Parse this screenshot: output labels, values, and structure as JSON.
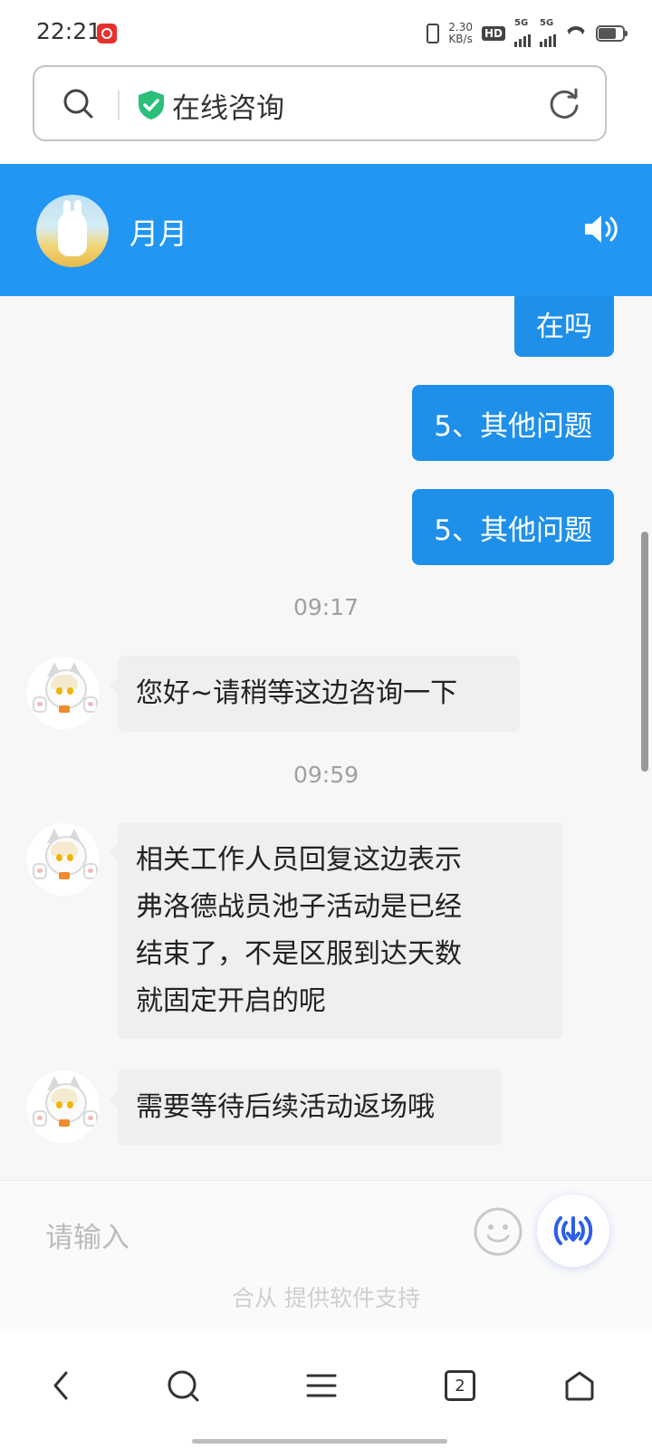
{
  "status_bar": {
    "time": "22:21",
    "net_speed_value": "2.30",
    "net_speed_unit": "KB/s",
    "hd_label": "HD",
    "signal_1_label": "5G",
    "signal_2_label": "5G"
  },
  "url_bar": {
    "title": "在线咨询",
    "search_icon": "search-icon",
    "secure_icon": "shield-check-icon",
    "reload_icon": "reload-icon"
  },
  "chat_header": {
    "agent_name": "月月",
    "accent_color": "#2196f3",
    "speaker_icon": "speaker-icon"
  },
  "messages": [
    {
      "type": "outgoing",
      "text": "在吗"
    },
    {
      "type": "outgoing",
      "text": "5、其他问题"
    },
    {
      "type": "outgoing",
      "text": "5、其他问题"
    },
    {
      "type": "timestamp",
      "text": "09:17"
    },
    {
      "type": "incoming",
      "text": "您好~请稍等这边咨询一下"
    },
    {
      "type": "timestamp",
      "text": "09:59"
    },
    {
      "type": "incoming",
      "lines": [
        "相关工作人员回复这边表示",
        "弗洛德战员池子活动是已经",
        "结束了，不是区服到达天数",
        "就固定开启的呢"
      ]
    },
    {
      "type": "incoming",
      "text": "需要等待后续活动返场哦"
    }
  ],
  "input": {
    "placeholder": "请输入",
    "emoji_icon": "emoji-icon",
    "voice_icon": "voice-icon"
  },
  "powered_by": "合从 提供软件支持",
  "bottom_nav": {
    "back_icon": "back-icon",
    "search_icon": "search-icon",
    "menu_icon": "menu-icon",
    "tabs_count": "2",
    "home_icon": "home-icon"
  }
}
